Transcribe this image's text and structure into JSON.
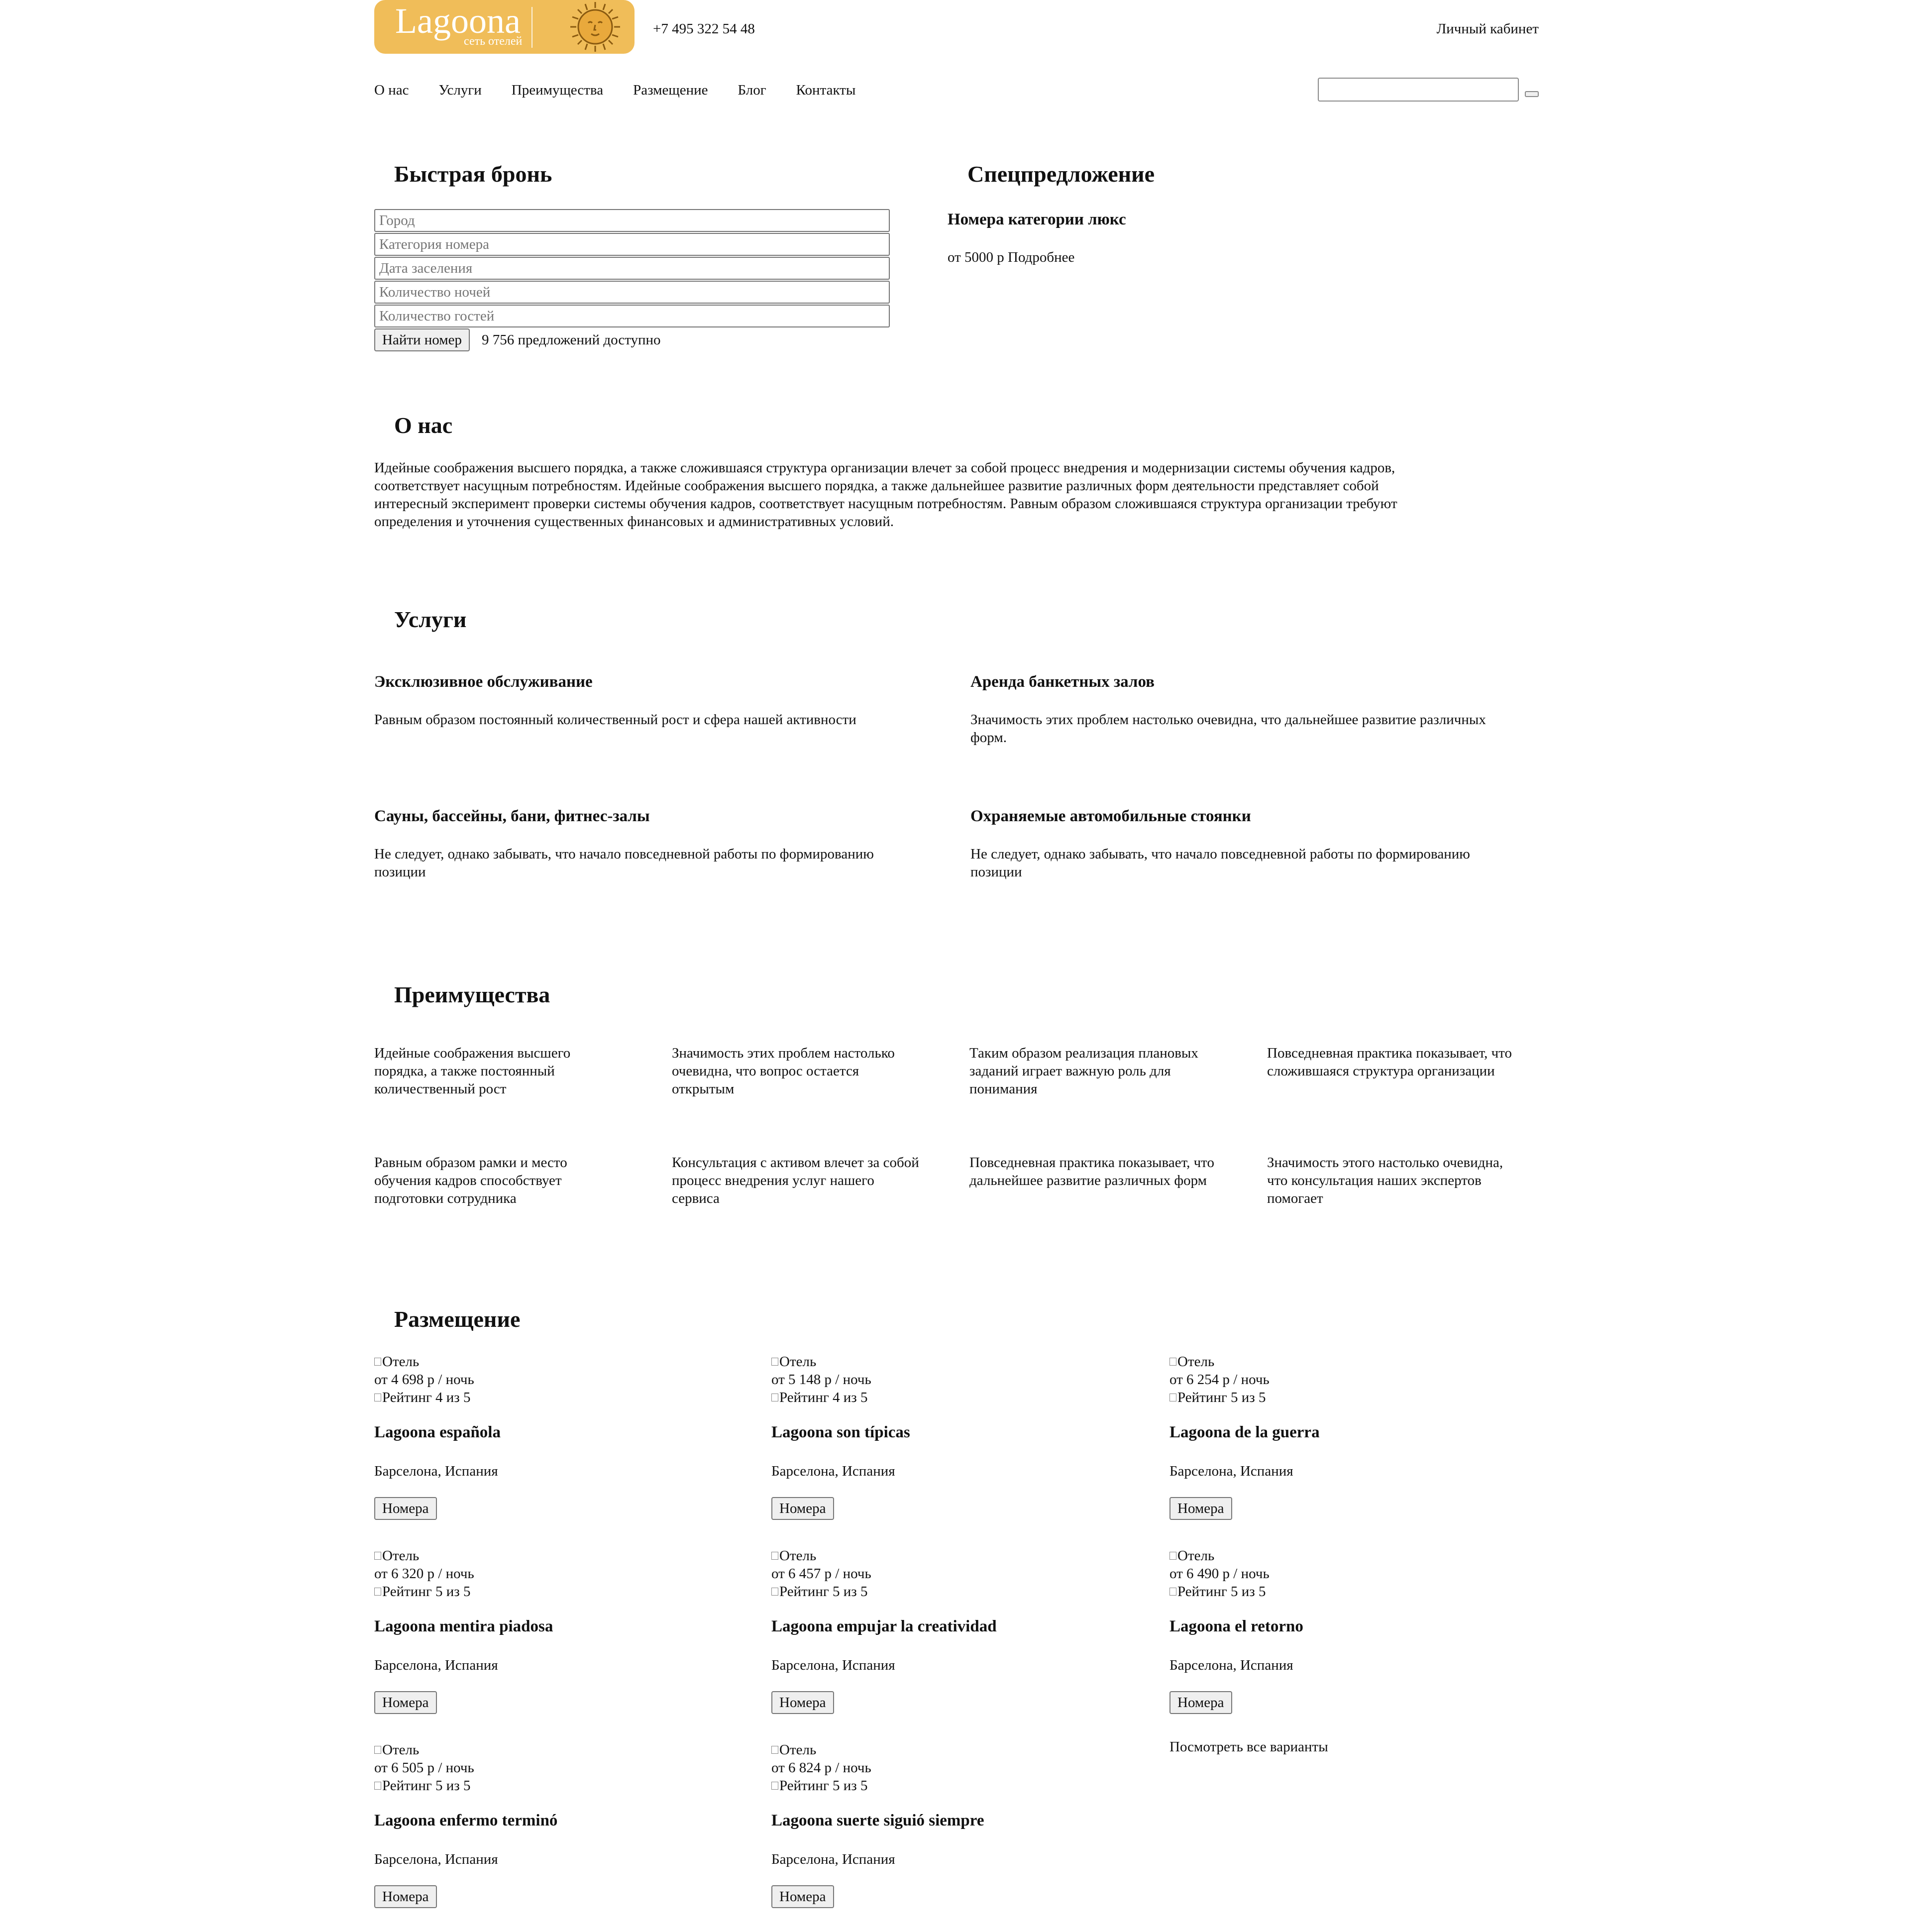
{
  "header": {
    "logo_name": "Lagoona",
    "logo_tagline": "сеть отелей",
    "phone": "+7 495 322 54 48",
    "cabinet": "Личный кабинет"
  },
  "nav": [
    "О нас",
    "Услуги",
    "Преимущества",
    "Размещение",
    "Блог",
    "Контакты"
  ],
  "booking": {
    "title": "Быстрая бронь",
    "fields": [
      "Город",
      "Категория номера",
      "Дата заселения",
      "Количество ночей",
      "Количество гостей"
    ],
    "button": "Найти номер",
    "offers": "9 756 предложений доступно"
  },
  "special": {
    "title": "Спецпредложение",
    "subtitle": "Номера категории люкс",
    "text": "от 5000 р Подробнее"
  },
  "about": {
    "title": "О нас",
    "lines": [
      "Идейные соображения высшего порядка, а также сложившаяся структура организации влечет за собой процесс внедрения и модернизации системы обучения кадров,",
      "соответствует насущным потребностям. Идейные соображения высшего порядка, а также дальнейшее развитие различных форм деятельности представляет собой",
      "интересный эксперимент проверки системы обучения кадров, соответствует насущным потребностям. Равным образом сложившаяся структура организации требуют",
      "определения и уточнения существенных финансовых и административных условий."
    ]
  },
  "services": {
    "title": "Услуги",
    "items": [
      {
        "title": "Эксклюзивное обслуживание",
        "lines": [
          "Равным образом постоянный количественный рост и сфера нашей активности"
        ]
      },
      {
        "title": "Аренда банкетных залов",
        "lines": [
          "Значимость этих проблем настолько очевидна, что дальнейшее развитие различных",
          "форм."
        ]
      },
      {
        "title": "Сауны, бассейны, бани, фитнес-залы",
        "lines": [
          "Не следует, однако забывать, что начало повседневной работы по формированию",
          "позиции"
        ]
      },
      {
        "title": "Охраняемые автомобильные стоянки",
        "lines": [
          "Не следует, однако забывать, что начало повседневной работы по формированию",
          "позиции"
        ]
      }
    ]
  },
  "advantages": {
    "title": "Преимущества",
    "items": [
      [
        "Идейные соображения высшего",
        "порядка, а также постоянный",
        "количественный рост"
      ],
      [
        "Значимость этих проблем настолько",
        "очевидна, что вопрос остается",
        "открытым"
      ],
      [
        "Таким образом реализация плановых",
        "заданий играет важную роль для",
        "понимания"
      ],
      [
        "Повседневная практика показывает, что",
        "сложившаяся структура организации"
      ],
      [
        "Равным образом рамки и место",
        "обучения кадров способствует",
        "подготовки сотрудника"
      ],
      [
        "Консультация с активом влечет за собой",
        "процесс внедрения услуг нашего",
        "сервиса"
      ],
      [
        "Повседневная практика показывает, что",
        "дальнейшее развитие различных форм"
      ],
      [
        "Значимость этого настолько очевидна,",
        "что консультация наших экспертов",
        "помогает"
      ]
    ]
  },
  "placement": {
    "title": "Размещение",
    "hotels": [
      {
        "img_alt": "Отель",
        "price": "от 4 698 р / ночь",
        "rating": "Рейтинг 4 из 5",
        "name": "Lagoona española",
        "location": "Барселона, Испания",
        "button": "Номера"
      },
      {
        "img_alt": "Отель",
        "price": "от 5 148 р / ночь",
        "rating": "Рейтинг 4 из 5",
        "name": "Lagoona son típicas",
        "location": "Барселона, Испания",
        "button": "Номера"
      },
      {
        "img_alt": "Отель",
        "price": "от 6 254 р / ночь",
        "rating": "Рейтинг 5 из 5",
        "name": "Lagoona de la guerra",
        "location": "Барселона, Испания",
        "button": "Номера"
      },
      {
        "img_alt": "Отель",
        "price": "от 6 320 р / ночь",
        "rating": "Рейтинг 5 из 5",
        "name": "Lagoona mentira piadosa",
        "location": "Барселона, Испания",
        "button": "Номера"
      },
      {
        "img_alt": "Отель",
        "price": "от 6 457 р / ночь",
        "rating": "Рейтинг 5 из 5",
        "name": "Lagoona empujar la creatividad",
        "location": "Барселона, Испания",
        "button": "Номера"
      },
      {
        "img_alt": "Отель",
        "price": "от 6 490 р / ночь",
        "rating": "Рейтинг 5 из 5",
        "name": "Lagoona el retorno",
        "location": "Барселона, Испания",
        "button": "Номера"
      },
      {
        "img_alt": "Отель",
        "price": "от 6 505 р / ночь",
        "rating": "Рейтинг 5 из 5",
        "name": "Lagoona enfermo terminó",
        "location": "Барселона, Испания",
        "button": "Номера"
      },
      {
        "img_alt": "Отель",
        "price": "от 6 824 р / ночь",
        "rating": "Рейтинг 5 из 5",
        "name": "Lagoona suerte siguió siempre",
        "location": "Барселона, Испания",
        "button": "Номера"
      }
    ],
    "view_all": "Посмотреть все варианты"
  },
  "colors": {
    "logo_bg": "#f0bd59"
  }
}
